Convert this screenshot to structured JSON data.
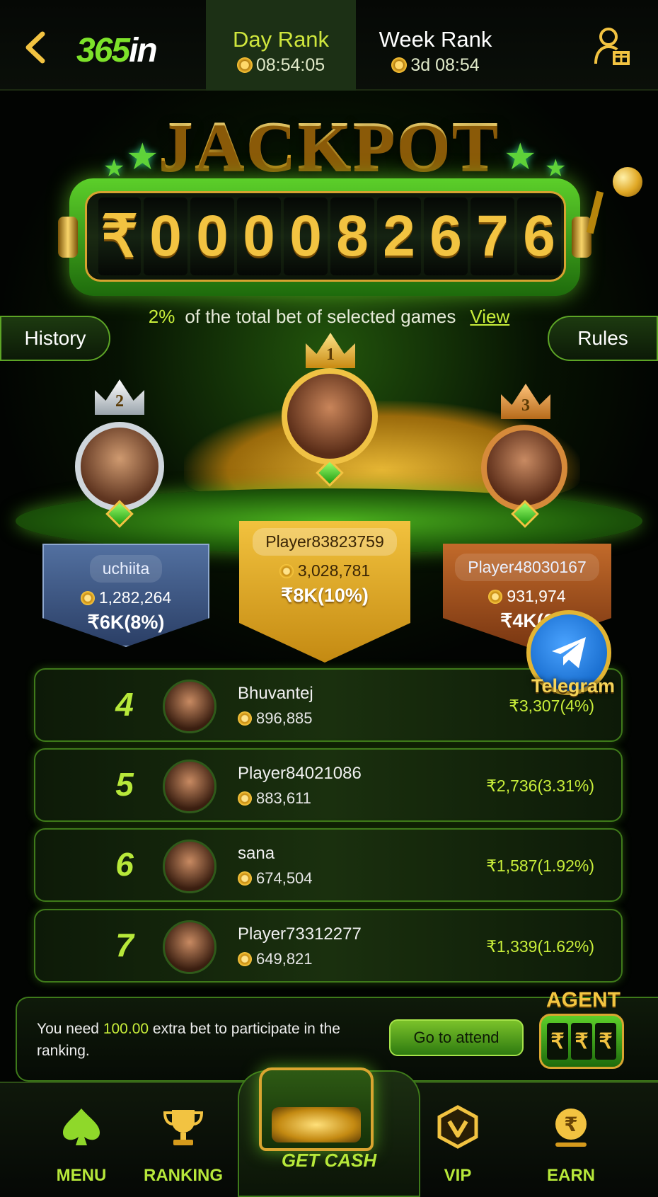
{
  "header": {
    "logo": {
      "part1": "365",
      "part2": "in"
    },
    "tabs": [
      {
        "label": "Day Rank",
        "timer": "08:54:05",
        "active": true
      },
      {
        "label": "Week Rank",
        "timer": "3d 08:54",
        "active": false
      }
    ],
    "back_icon": "chevron-left-icon",
    "gift_icon": "user-gift-icon"
  },
  "jackpot": {
    "title": "JACKPOT",
    "currency": "₹",
    "digits": [
      "0",
      "0",
      "0",
      "0",
      "8",
      "2",
      "6",
      "7",
      "6"
    ],
    "percent": "2%",
    "description": "of the total bet of selected games",
    "view_label": "View",
    "history_label": "History",
    "rules_label": "Rules"
  },
  "podium": [
    {
      "rank": "2",
      "name": "uchiita",
      "score": "1,282,264",
      "prize": "₹6K(8%)"
    },
    {
      "rank": "1",
      "name": "Player83823759",
      "score": "3,028,781",
      "prize": "₹8K(10%)"
    },
    {
      "rank": "3",
      "name": "Player48030167",
      "score": "931,974",
      "prize": "₹4K(6"
    }
  ],
  "ranking": [
    {
      "rank": "4",
      "name": "Bhuvantej",
      "score": "896,885",
      "prize": "₹3,307(4%)"
    },
    {
      "rank": "5",
      "name": "Player84021086",
      "score": "883,611",
      "prize": "₹2,736(3.31%)"
    },
    {
      "rank": "6",
      "name": "sana",
      "score": "674,504",
      "prize": "₹1,587(1.92%)"
    },
    {
      "rank": "7",
      "name": "Player73312277",
      "score": "649,821",
      "prize": "₹1,339(1.62%)"
    }
  ],
  "telegram": {
    "label": "Telegram",
    "icon": "telegram-icon"
  },
  "notice": {
    "before": "You need ",
    "amount": "100.00",
    "after": " extra bet to participate in the ranking.",
    "button": "Go to attend"
  },
  "agent": {
    "title": "AGENT",
    "symbols": [
      "₹",
      "₹",
      "₹"
    ]
  },
  "nav": [
    {
      "label": "MENU",
      "icon": "spade-icon"
    },
    {
      "label": "RANKING",
      "icon": "trophy-icon"
    },
    {
      "label": "GET CASH",
      "icon": "treasure-chest-icon"
    },
    {
      "label": "VIP",
      "icon": "vip-shield-icon"
    },
    {
      "label": "EARN",
      "icon": "rupee-coin-icon"
    }
  ],
  "colors": {
    "accent": "#b7e83a",
    "gold": "#f2c341",
    "background": "#020402"
  }
}
